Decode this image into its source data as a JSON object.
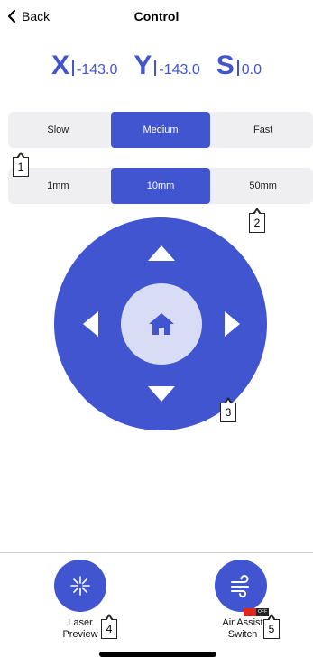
{
  "header": {
    "back_label": "Back",
    "title": "Control"
  },
  "coords": {
    "x_label": "X",
    "x_value": "-143.0",
    "y_label": "Y",
    "y_value": "-143.0",
    "s_label": "S",
    "s_value": "0.0"
  },
  "speed": {
    "options": [
      "Slow",
      "Medium",
      "Fast"
    ],
    "selected": "Medium"
  },
  "step": {
    "options": [
      "1mm",
      "10mm",
      "50mm"
    ],
    "selected": "10mm"
  },
  "bottom": {
    "laser_preview_label": "Laser\nPreview",
    "air_assist_label": "Air Assist\nSwitch",
    "air_assist_state": "OFF"
  },
  "callouts": [
    "1",
    "2",
    "3",
    "4",
    "5"
  ],
  "colors": {
    "accent": "#4055cf",
    "home_bg": "#d9dcf5",
    "toggle_red": "#e0271f"
  },
  "icons": [
    "chevron-left-icon",
    "home-icon",
    "laser-burst-icon",
    "air-assist-icon"
  ]
}
